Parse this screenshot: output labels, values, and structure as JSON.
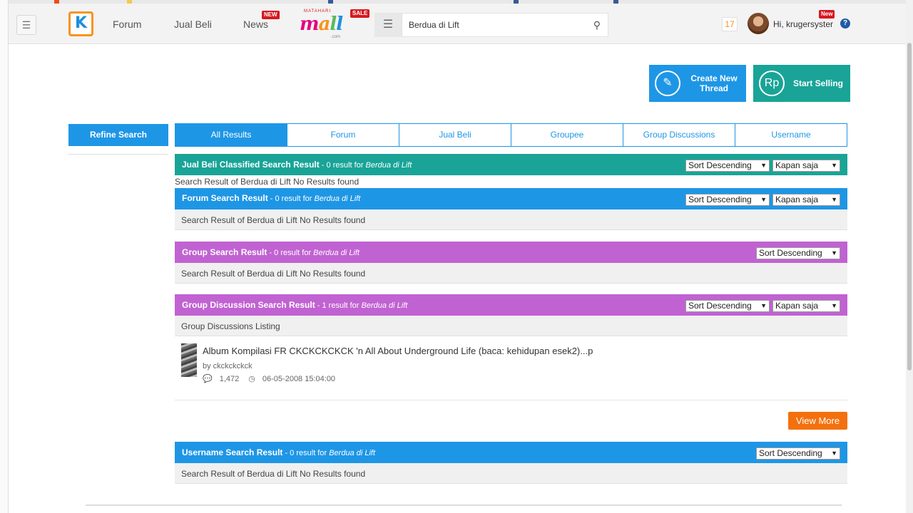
{
  "topbar": {
    "menu_icon": "hamburger-icon",
    "logo_text": "K",
    "nav": {
      "forum": "Forum",
      "jual_beli": "Jual Beli",
      "news": "News"
    },
    "news_badge": "NEW",
    "mall": {
      "top": "MATAHARI",
      "word_1": "m",
      "word_2": "a",
      "word_3": "l",
      "word_4": "l",
      "domain": ".com"
    },
    "sale_badge": "SALE",
    "search_value": "Berdua di Lift",
    "search_icon": "search-icon",
    "notif_count": "17",
    "greeting": "Hi, krugersyster",
    "user_badge": "New",
    "help_icon": "?"
  },
  "actions": {
    "create_icon": "pencil-icon",
    "create_label": "Create New Thread",
    "sell_icon": "Rp",
    "sell_label": "Start Selling"
  },
  "refine_label": "Refine Search",
  "tabs": [
    "All Results",
    "Forum",
    "Jual Beli",
    "Groupee",
    "Group Discussions",
    "Username"
  ],
  "sort_label": "Sort Descending",
  "when_label": "Kapan saja",
  "sections": {
    "jual_beli": {
      "title": "Jual Beli Classified Search Result",
      "count": " - 0 result for ",
      "query": "Berdua di Lift",
      "body": "Search Result of Berdua di Lift No Results found"
    },
    "forum": {
      "title": "Forum Search Result",
      "count": " - 0 result for ",
      "query": "Berdua di Lift",
      "body": "Search Result of Berdua di Lift No Results found"
    },
    "group": {
      "title": "Group Search Result",
      "count": " - 0 result for ",
      "query": "Berdua di Lift",
      "body": "Search Result of Berdua di Lift No Results found"
    },
    "group_discussion": {
      "title": "Group Discussion Search Result",
      "count": " - 1 result for ",
      "query": "Berdua di Lift",
      "body": "Group Discussions Listing"
    },
    "username": {
      "title": "Username Search Result",
      "count": " - 0 result for ",
      "query": "Berdua di Lift",
      "body": "Search Result of Berdua di Lift No Results found"
    }
  },
  "discussion": {
    "title": "Album Kompilasi FR CKCKCKCKCK 'n All About Underground Life (baca: kehidupan esek2)...p",
    "author": "by ckckckckck",
    "comments": "1,472",
    "date": "06-05-2008 15:04:00"
  },
  "view_more": "View More",
  "colors": {
    "blue": "#1e96e6",
    "teal": "#19a497",
    "purple": "#c162d2",
    "orange": "#f4700d"
  }
}
